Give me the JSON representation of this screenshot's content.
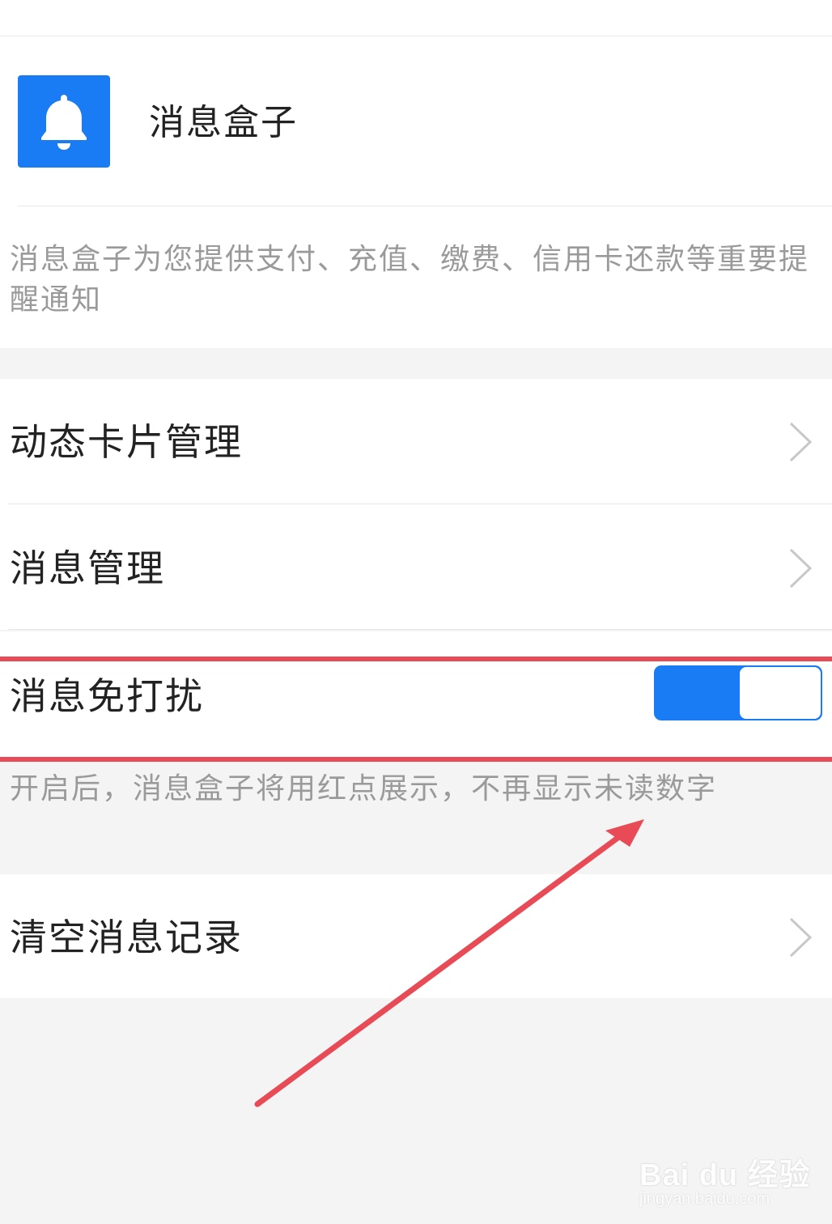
{
  "header": {
    "app_title": "消息盒子",
    "app_icon": "bell-icon",
    "description": "消息盒子为您提供支付、充值、缴费、信用卡还款等重要提醒通知"
  },
  "menu": {
    "card_management": "动态卡片管理",
    "message_management": "消息管理",
    "chevron_icon": "chevron-right-icon"
  },
  "dnd": {
    "label": "消息免打扰",
    "enabled": true,
    "hint": "开启后，消息盒子将用红点展示，不再显示未读数字"
  },
  "clear": {
    "label": "清空消息记录"
  },
  "watermark": {
    "main": "Bai du 经验",
    "sub": "jingyan.baidu.com"
  },
  "colors": {
    "accent": "#1a7cf4",
    "annotation_red": "#e84b55",
    "hint_text": "#9a9a9a",
    "page_bg": "#f4f4f4"
  }
}
